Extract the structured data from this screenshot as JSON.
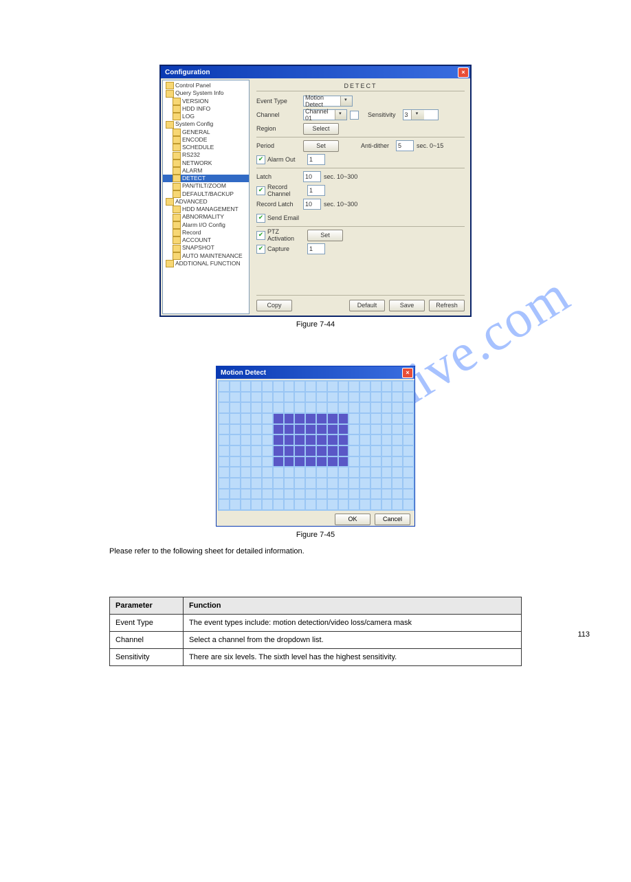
{
  "configWindow": {
    "title": "Configuration",
    "tree": [
      {
        "label": "Control Panel",
        "lev": 0,
        "icon": true
      },
      {
        "label": "Query System Info",
        "lev": 0,
        "icon": true
      },
      {
        "label": "VERSION",
        "lev": 1,
        "icon": true
      },
      {
        "label": "HDD INFO",
        "lev": 1,
        "icon": true
      },
      {
        "label": "LOG",
        "lev": 1,
        "icon": true
      },
      {
        "label": "System Config",
        "lev": 0,
        "icon": true
      },
      {
        "label": "GENERAL",
        "lev": 1,
        "icon": true
      },
      {
        "label": "ENCODE",
        "lev": 1,
        "icon": true
      },
      {
        "label": "SCHEDULE",
        "lev": 1,
        "icon": true
      },
      {
        "label": "RS232",
        "lev": 1,
        "icon": true
      },
      {
        "label": "NETWORK",
        "lev": 1,
        "icon": true
      },
      {
        "label": "ALARM",
        "lev": 1,
        "icon": true
      },
      {
        "label": "DETECT",
        "lev": 1,
        "icon": true,
        "sel": true
      },
      {
        "label": "PAN/TILT/ZOOM",
        "lev": 1,
        "icon": true
      },
      {
        "label": "DEFAULT/BACKUP",
        "lev": 1,
        "icon": true
      },
      {
        "label": "ADVANCED",
        "lev": 0,
        "icon": true
      },
      {
        "label": "HDD MANAGEMENT",
        "lev": 1,
        "icon": true
      },
      {
        "label": "ABNORMALITY",
        "lev": 1,
        "icon": true
      },
      {
        "label": "Alarm I/O Config",
        "lev": 1,
        "icon": true
      },
      {
        "label": "Record",
        "lev": 1,
        "icon": true
      },
      {
        "label": "ACCOUNT",
        "lev": 1,
        "icon": true
      },
      {
        "label": "SNAPSHOT",
        "lev": 1,
        "icon": true
      },
      {
        "label": "AUTO MAINTENANCE",
        "lev": 1,
        "icon": true
      },
      {
        "label": "ADDTIONAL FUNCTION",
        "lev": 0,
        "icon": true
      }
    ],
    "paneTitle": "DETECT",
    "eventType": {
      "label": "Event Type",
      "value": "Motion Detect"
    },
    "channel": {
      "label": "Channel",
      "value": "Channel 01"
    },
    "sensitivity": {
      "label": "Sensitivity",
      "value": "3"
    },
    "region": {
      "label": "Region",
      "btn": "Select"
    },
    "period": {
      "label": "Period",
      "btn": "Set"
    },
    "antiDither": {
      "label": "Anti-dither",
      "value": "5",
      "suffix": "sec.   0~15"
    },
    "alarmOut": {
      "label": "Alarm Out",
      "checked": true,
      "value": "1"
    },
    "latch": {
      "label": "Latch",
      "value": "10",
      "suffix": "sec.   10~300"
    },
    "recordChannel": {
      "label": "Record Channel",
      "checked": true,
      "value": "1"
    },
    "recordLatch": {
      "label": "Record Latch",
      "value": "10",
      "suffix": "sec.   10~300"
    },
    "sendEmail": {
      "label": "Send Email",
      "checked": true
    },
    "ptz": {
      "label": "PTZ Activation",
      "checked": true,
      "btn": "Set"
    },
    "capture": {
      "label": "Capture",
      "checked": true,
      "value": "1"
    },
    "bottom": {
      "copy": "Copy",
      "default": "Default",
      "save": "Save",
      "refresh": "Refresh"
    }
  },
  "figure1": "Figure 7-44",
  "motionDetect": {
    "title": "Motion Detect",
    "ok": "OK",
    "cancel": "Cancel",
    "grid": {
      "cols": 18,
      "rows": 12,
      "sel": {
        "r0": 3,
        "r1": 7,
        "c0": 5,
        "c1": 11
      }
    }
  },
  "figure2": "Figure 7-45",
  "introText": "Please refer to the following sheet for detailed information.",
  "table": {
    "head": [
      "Parameter",
      "Function"
    ],
    "rows": [
      [
        "Event Type",
        "The event types include: motion detection/video loss/camera mask"
      ],
      [
        "Channel",
        "Select a channel from the dropdown list."
      ],
      [
        "Sensitivity",
        "There are six levels. The sixth level has the highest sensitivity."
      ]
    ]
  },
  "pageNum": "113"
}
